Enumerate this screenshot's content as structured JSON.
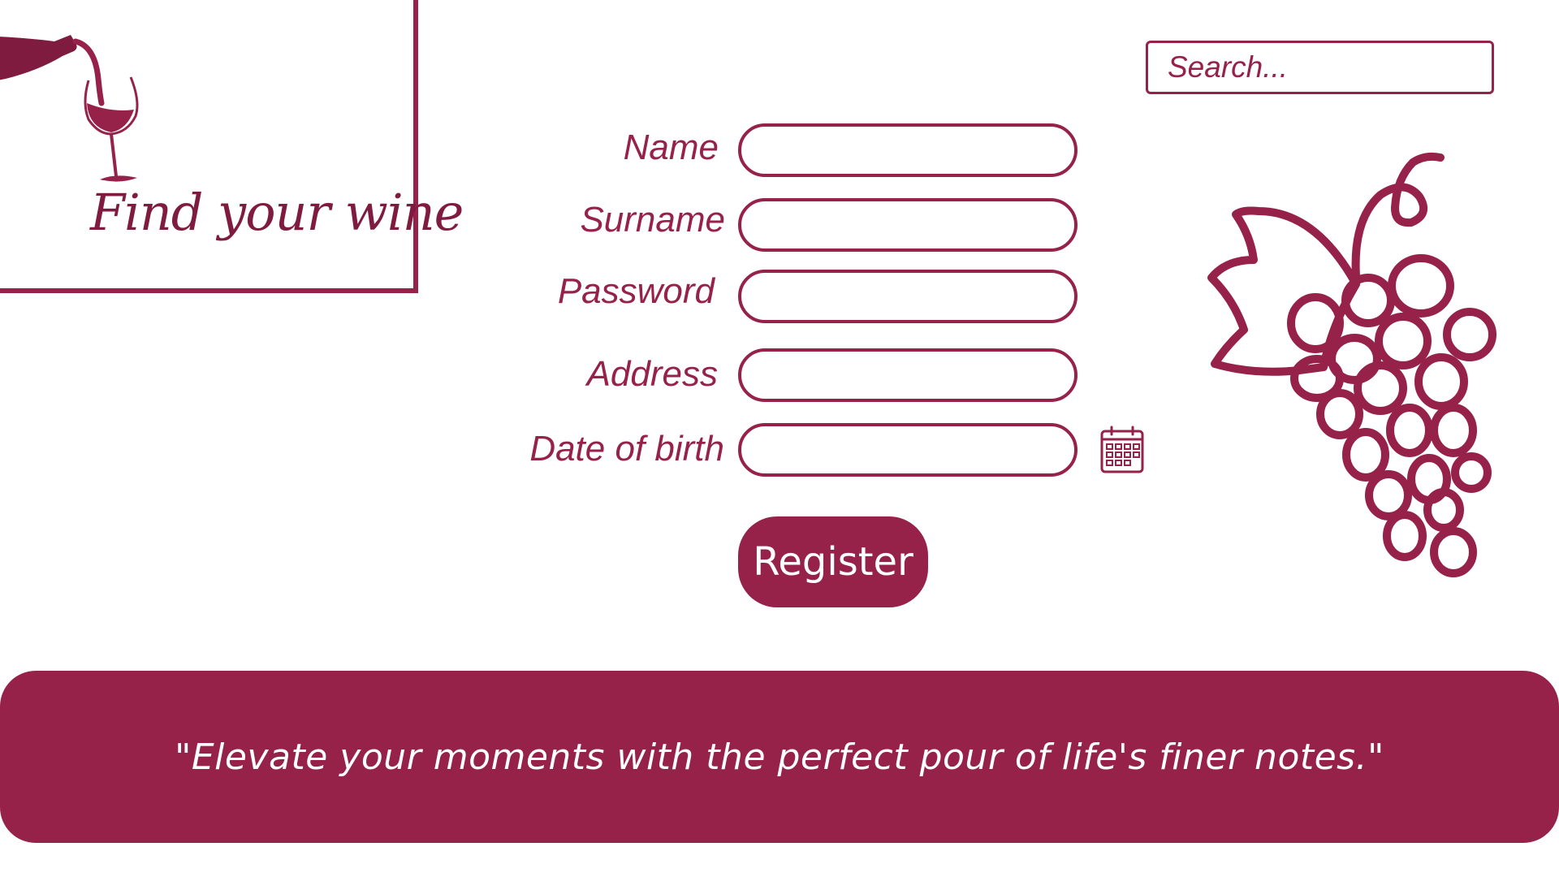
{
  "logo": {
    "title": "Find your wine",
    "icon": "wine-pour-icon"
  },
  "search": {
    "placeholder": "Search..."
  },
  "form": {
    "fields": [
      {
        "label": "Name",
        "value": ""
      },
      {
        "label": "Surname",
        "value": ""
      },
      {
        "label": "Password",
        "value": ""
      },
      {
        "label": "Address",
        "value": ""
      },
      {
        "label": "Date of birth",
        "value": ""
      }
    ],
    "calendar_icon": "calendar-icon",
    "register_label": "Register"
  },
  "decor": {
    "illustration": "grapes-icon"
  },
  "footer": {
    "quote": "\"Elevate your moments with the perfect pour of life's finer notes.\""
  },
  "colors": {
    "accent": "#96224a",
    "background": "#ffffff",
    "on_accent": "#ffffff"
  }
}
